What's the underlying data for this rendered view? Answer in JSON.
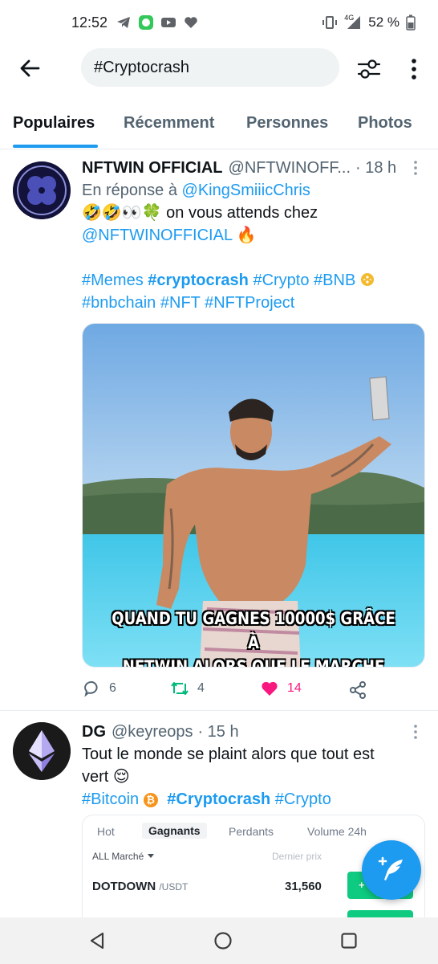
{
  "status_bar": {
    "time": "12:52",
    "battery": "52 %",
    "network": "4G",
    "left_icons": [
      "telegram-icon",
      "messenger-icon",
      "youtube-icon",
      "heart-icon"
    ]
  },
  "search": {
    "query": "#Cryptocrash"
  },
  "tabs": [
    {
      "label": "Populaires",
      "active": true
    },
    {
      "label": "Récemment",
      "active": false
    },
    {
      "label": "Personnes",
      "active": false
    },
    {
      "label": "Photos",
      "active": false
    }
  ],
  "tweets": [
    {
      "name": "NFTWIN OFFICIAL",
      "handle": "@NFTWINOFF...",
      "time": "· 18 h",
      "reply_prefix": "En réponse à ",
      "reply_to": "@KingSmiiicChris",
      "text_emoji": "🤣🤣👀🍀",
      "text_1": " on vous attends chez",
      "mention": "@NFTWINOFFICIAL",
      "text_emoji_2": " 🔥",
      "hashtags_line1": [
        "#Memes",
        "#cryptocrash",
        "#Crypto",
        "#BNB"
      ],
      "hashtags_line2": [
        "#bnbchain",
        "#NFT",
        "#NFTProject"
      ],
      "media_caption_1": "QUAND TU GAGNES 10000$ GRÂCE À",
      "media_caption_2": "NFTWIN ALORS QUE LE MARCHE SAIGNE",
      "replies": "6",
      "retweets": "4",
      "likes": "14",
      "liked": true
    },
    {
      "name": "DG",
      "handle": "@keyreops",
      "time": "· 15 h",
      "text_1": "Tout le monde se plaint alors que tout est",
      "text_2": "vert 😌",
      "hashtag_bitcoin": "#Bitcoin",
      "bitcoin_symbol": "₿",
      "hashtag_cryptocrash": "#Cryptocrash",
      "hashtag_crypto": "#Crypto"
    }
  ],
  "market_card": {
    "tabs": [
      "Hot",
      "Gagnants",
      "Perdants",
      "Volume 24h"
    ],
    "selected_tab": "Gagnants",
    "filter": "ALL Marché",
    "price_header": "Dernier prix",
    "pair": "DOTDOWN",
    "quote": "/USDT",
    "price": "31,560",
    "change_prefix": "+"
  },
  "colors": {
    "accent": "#1d9bf0",
    "like": "#f91880",
    "retweet": "#00ba7c",
    "buy_green": "#0ecb81"
  }
}
